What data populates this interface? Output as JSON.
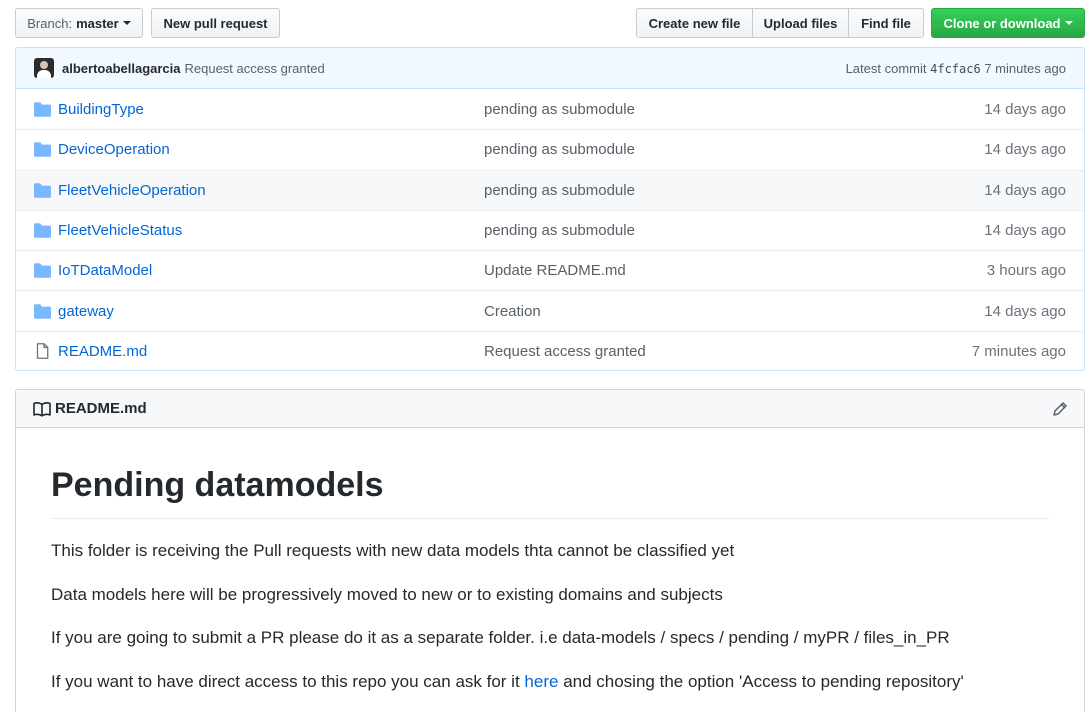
{
  "toolbar": {
    "branch_prefix": "Branch:",
    "branch_name": "master",
    "new_pull_request": "New pull request",
    "create_new_file": "Create new file",
    "upload_files": "Upload files",
    "find_file": "Find file",
    "clone_or_download": "Clone or download"
  },
  "commit": {
    "author": "albertoabellagarcia",
    "message": "Request access granted",
    "latest_label": "Latest commit",
    "sha": "4fcfac6",
    "time": "7 minutes ago"
  },
  "files": [
    {
      "name": "BuildingType",
      "type": "folder",
      "message": "pending as submodule",
      "age": "14 days ago"
    },
    {
      "name": "DeviceOperation",
      "type": "folder",
      "message": "pending as submodule",
      "age": "14 days ago"
    },
    {
      "name": "FleetVehicleOperation",
      "type": "folder",
      "message": "pending as submodule",
      "age": "14 days ago"
    },
    {
      "name": "FleetVehicleStatus",
      "type": "folder",
      "message": "pending as submodule",
      "age": "14 days ago"
    },
    {
      "name": "IoTDataModel",
      "type": "folder",
      "message": "Update README.md",
      "age": "3 hours ago"
    },
    {
      "name": "gateway",
      "type": "folder",
      "message": "Creation",
      "age": "14 days ago"
    },
    {
      "name": "README.md",
      "type": "file",
      "message": "Request access granted",
      "age": "7 minutes ago"
    }
  ],
  "readme": {
    "filename": "README.md",
    "heading": "Pending datamodels",
    "p1": "This folder is receiving the Pull requests with new data models thta cannot be classified yet",
    "p2": "Data models here will be progressively moved to new or to existing domains and subjects",
    "p3": "If you are going to submit a PR please do it as a separate folder. i.e data-models / specs / pending / myPR / files_in_PR",
    "p4_before": "If you want to have direct access to this repo you can ask for it",
    "p4_link": "here",
    "p4_after": "and chosing the option 'Access to pending repository'"
  },
  "colors": {
    "link": "#0366d6",
    "green": "#28a745",
    "folder_icon": "#79b8ff"
  }
}
